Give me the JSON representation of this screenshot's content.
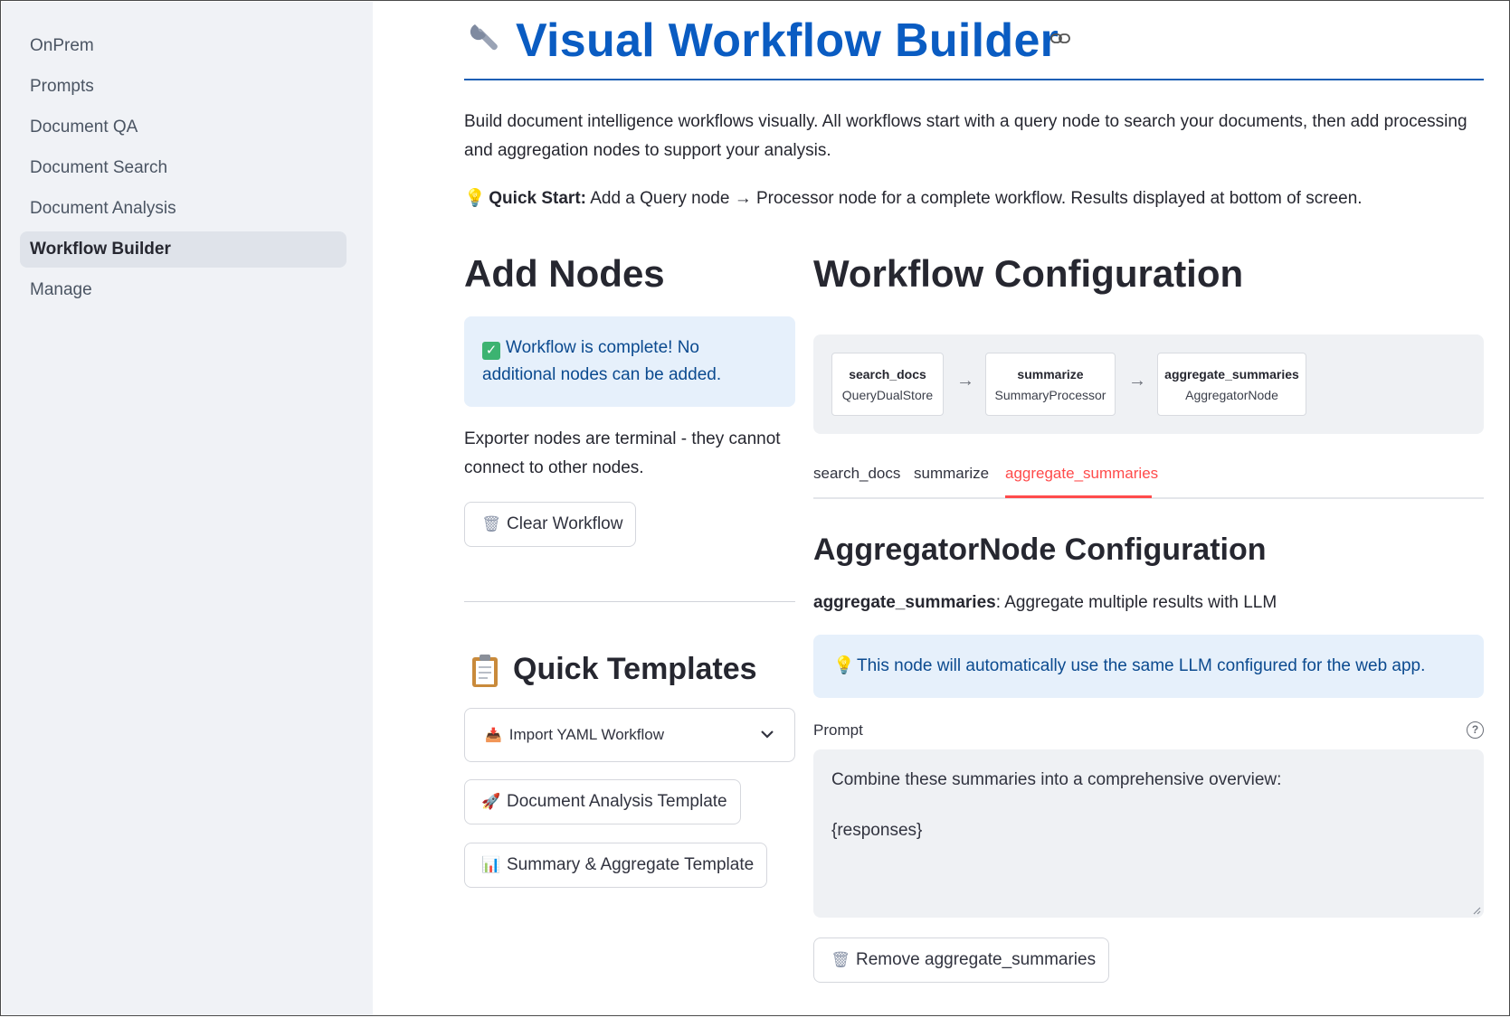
{
  "sidebar": {
    "items": [
      {
        "label": "OnPrem"
      },
      {
        "label": "Prompts"
      },
      {
        "label": "Document QA"
      },
      {
        "label": "Document Search"
      },
      {
        "label": "Document Analysis"
      },
      {
        "label": "Workflow Builder",
        "active": true
      },
      {
        "label": "Manage"
      }
    ]
  },
  "header": {
    "title_icon": "wrench-icon",
    "title": "Visual Workflow Builder",
    "link_icon": "link-icon"
  },
  "intro": {
    "description": "Build document intelligence workflows visually. All workflows start with a query node to search your documents, then add processing and aggregation nodes to support your analysis.",
    "quick_start_label": "Quick Start:",
    "quick_start_text": "Add a Query node → Processor node for a complete workflow. Results displayed at bottom of screen."
  },
  "add_nodes": {
    "heading": "Add Nodes",
    "complete_message": "Workflow is complete! No additional nodes can be added.",
    "exporter_note": "Exporter nodes are terminal - they cannot connect to other nodes.",
    "clear_button": "Clear Workflow"
  },
  "quick_templates": {
    "heading": "Quick Templates",
    "import_label": "Import YAML Workflow",
    "document_analysis_button": "Document Analysis Template",
    "summary_aggregate_button": "Summary & Aggregate Template"
  },
  "workflow_config": {
    "heading": "Workflow Configuration",
    "nodes": [
      {
        "name": "search_docs",
        "type": "QueryDualStore"
      },
      {
        "name": "summarize",
        "type": "SummaryProcessor"
      },
      {
        "name": "aggregate_summaries",
        "type": "AggregatorNode"
      }
    ],
    "arrow": "→",
    "tabs": [
      "search_docs",
      "summarize",
      "aggregate_summaries"
    ],
    "active_tab": "aggregate_summaries"
  },
  "node_config": {
    "heading": "AggregatorNode Configuration",
    "node_name": "aggregate_summaries",
    "node_desc": ": Aggregate multiple results with LLM",
    "info_message": "This node will automatically use the same LLM configured for the web app.",
    "prompt_label": "Prompt",
    "prompt_line1": "Combine these summaries into a comprehensive overview:",
    "prompt_line2": "{responses}",
    "remove_button": "Remove aggregate_summaries"
  },
  "colors": {
    "title": "#0a5cc2",
    "active_tab": "#ff4b4b",
    "info_text": "#0b4a8f",
    "info_bg": "#e6f0fb",
    "sidebar_bg": "#f0f2f6"
  }
}
